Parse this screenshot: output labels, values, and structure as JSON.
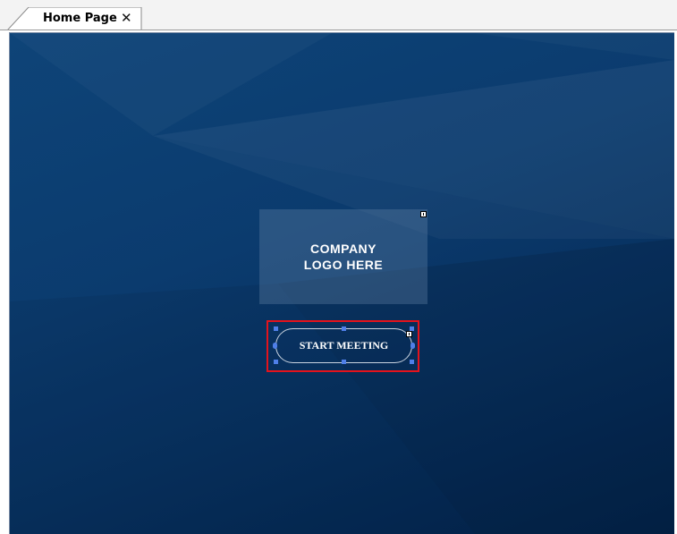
{
  "tab": {
    "label": "Home Page",
    "close_icon": "close-icon",
    "close_glyph": "✕"
  },
  "canvas": {
    "logo_placeholder": {
      "line1": "COMPANY",
      "line2": "LOGO HERE"
    },
    "start_button": {
      "label": "START MEETING"
    }
  },
  "colors": {
    "background_top": "#0e4478",
    "background_bottom": "#03234a",
    "selection_highlight": "#e4131c",
    "handle": "#4f7fe8"
  }
}
